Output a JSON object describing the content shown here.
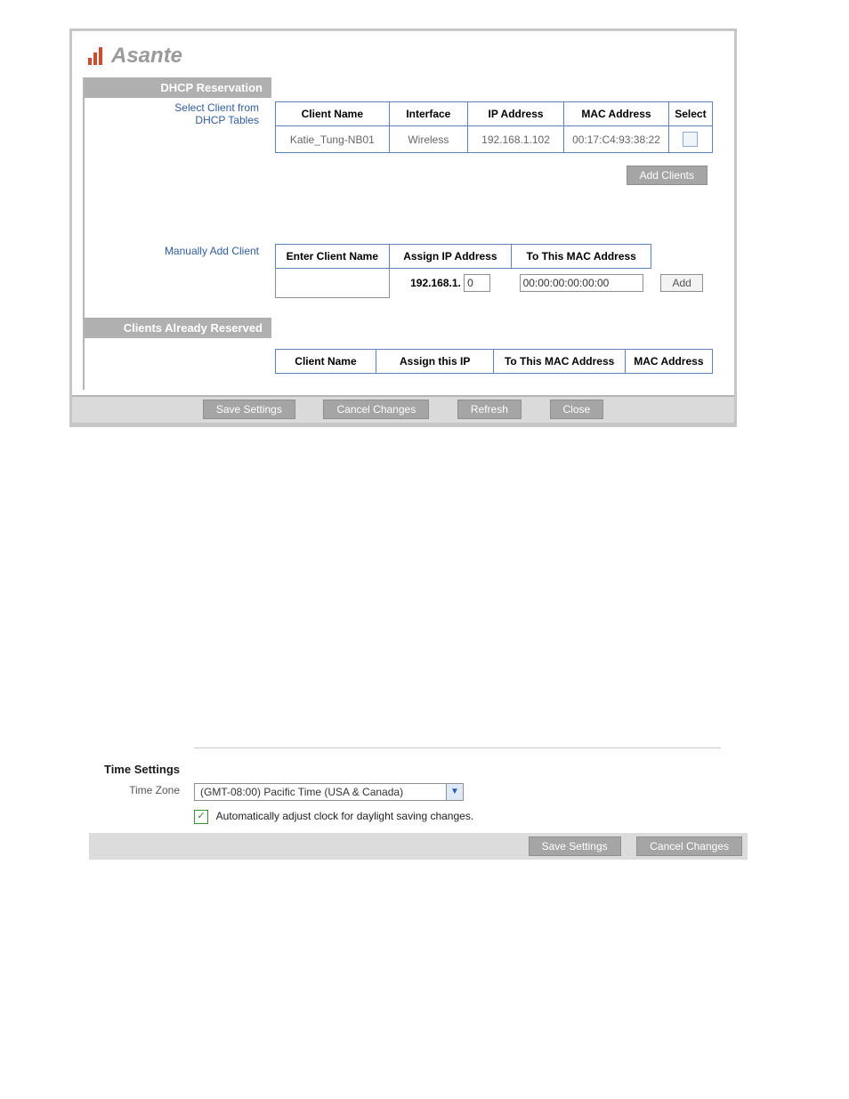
{
  "brand": "Asante",
  "dhcp": {
    "section_title": "DHCP Reservation",
    "select_label_line1": "Select Client from",
    "select_label_line2": "DHCP Tables",
    "table1": {
      "headers": [
        "Client Name",
        "Interface",
        "IP Address",
        "MAC Address",
        "Select"
      ],
      "row": {
        "client_name": "Katie_Tung-NB01",
        "interface": "Wireless",
        "ip": "192.168.1.102",
        "mac": "00:17:C4:93:38:22"
      }
    },
    "add_clients_label": "Add Clients",
    "manual_label": "Manually Add Client",
    "table2": {
      "headers": [
        "Enter Client Name",
        "Assign IP Address",
        "To This MAC Address",
        ""
      ],
      "ip_prefix": "192.168.1.",
      "ip_value": "0",
      "mac_value": "00:00:00:00:00:00",
      "add_label": "Add"
    },
    "reserved_title": "Clients Already Reserved",
    "table3_headers": [
      "Client Name",
      "Assign this IP",
      "To This MAC Address",
      "MAC Address"
    ],
    "buttons": {
      "save": "Save Settings",
      "cancel": "Cancel Changes",
      "refresh": "Refresh",
      "close": "Close"
    }
  },
  "time": {
    "heading": "Time Settings",
    "zone_label": "Time Zone",
    "zone_value": "(GMT-08:00) Pacific Time (USA & Canada)",
    "dst_label": "Automatically adjust clock for daylight saving changes.",
    "buttons": {
      "save": "Save Settings",
      "cancel": "Cancel Changes"
    }
  }
}
